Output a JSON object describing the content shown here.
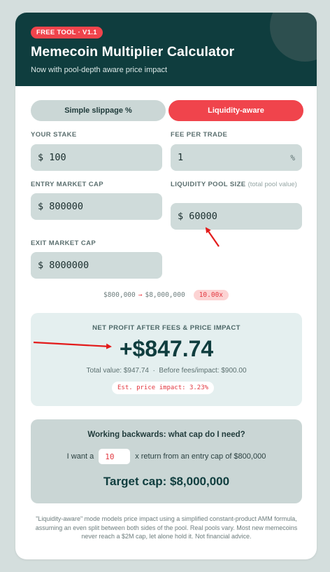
{
  "header": {
    "badge": "FREE TOOL · V1.1",
    "title": "Memecoin Multiplier Calculator",
    "subtitle": "Now with pool-depth aware price impact"
  },
  "modes": {
    "simple": "Simple slippage %",
    "liquidity": "Liquidity-aware",
    "active": "liquidity"
  },
  "fields": {
    "stake": {
      "label": "YOUR STAKE",
      "prefix": "$",
      "value": "100"
    },
    "fee": {
      "label": "FEE PER TRADE",
      "value": "1",
      "unit": "%"
    },
    "entry": {
      "label": "ENTRY MARKET CAP",
      "prefix": "$",
      "value": "800000"
    },
    "pool": {
      "label": "LIQUIDITY POOL SIZE",
      "aux": "(total pool value)",
      "prefix": "$",
      "value": "60000"
    },
    "exit": {
      "label": "EXIT MARKET CAP",
      "prefix": "$",
      "value": "8000000"
    }
  },
  "range": {
    "from": "$800,000",
    "arrow": "→",
    "to": "$8,000,000",
    "multiplier": "10.00x"
  },
  "result": {
    "label": "NET PROFIT AFTER FEES & PRICE IMPACT",
    "value": "+$847.74",
    "sub": "Total value: $947.74  ·  Before fees/impact: $900.00",
    "impact": "Est. price impact: 3.23%"
  },
  "backwards": {
    "title": "Working backwards: what cap do I need?",
    "prefix": "I want a",
    "value": "10",
    "suffix": "x return from an entry cap of $800,000",
    "target": "Target cap: $8,000,000"
  },
  "footer": "\"Liquidity-aware\" mode models price impact using a simplified constant-product AMM formula, assuming an even split between both sides of the pool. Real pools vary. Most new memecoins never reach a $2M cap, let alone hold it. Not financial advice.",
  "colors": {
    "header_bg": "#0f3d3e",
    "accent": "#f0444c",
    "field_bg": "#cfdbda",
    "annotation_arrow": "#e31b1b"
  }
}
